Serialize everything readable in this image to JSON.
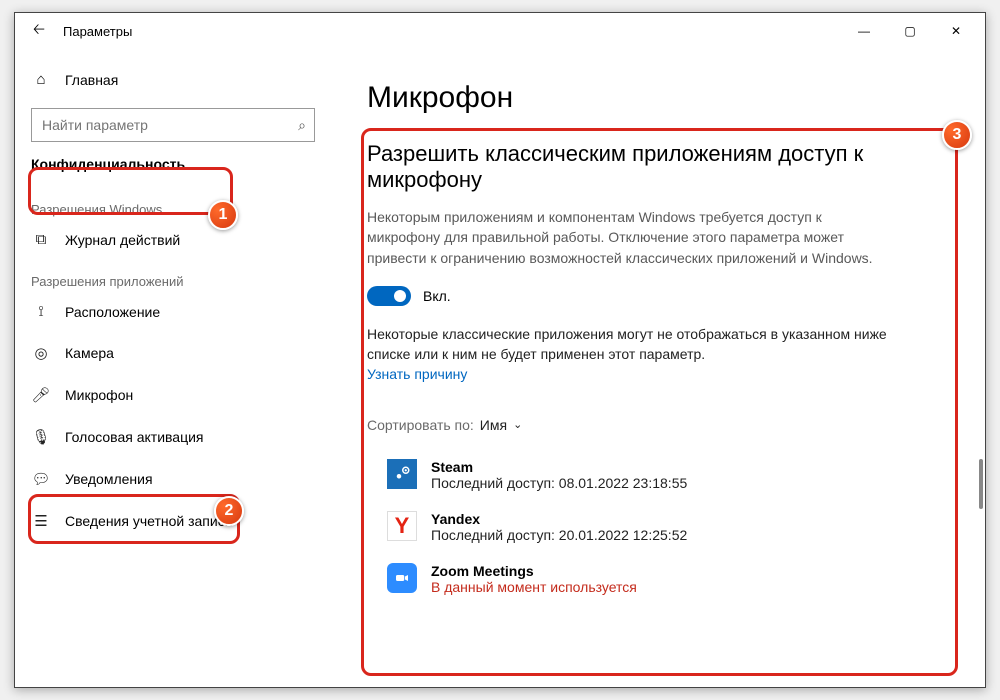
{
  "window": {
    "title": "Параметры"
  },
  "sidebar": {
    "home": "Главная",
    "search_placeholder": "Найти параметр",
    "section_privacy": "Конфиденциальность",
    "group_windows": "Разрешения Windows",
    "item_activity": "Журнал действий",
    "group_apps": "Разрешения приложений",
    "item_location": "Расположение",
    "item_camera": "Камера",
    "item_microphone": "Микрофон",
    "item_voice": "Голосовая активация",
    "item_notifications": "Уведомления",
    "item_account": "Сведения учетной записи"
  },
  "page": {
    "title": "Микрофон",
    "section_heading": "Разрешить классическим приложениям доступ к микрофону",
    "section_para": "Некоторым приложениям и компонентам Windows требуется доступ к микрофону для правильной работы. Отключение этого параметра может привести к ограничению возможностей классических приложений и Windows.",
    "toggle_label": "Вкл.",
    "list_note": "Некоторые классические приложения могут не отображаться в указанном ниже списке или к ним не будет применен этот параметр.",
    "learn_link": "Узнать причину",
    "sort_label": "Сортировать по:",
    "sort_value": "Имя",
    "apps": [
      {
        "name": "Steam",
        "sub": "Последний доступ: 08.01.2022 23:18:55",
        "inuse": false,
        "icon": "steam"
      },
      {
        "name": "Yandex",
        "sub": "Последний доступ: 20.01.2022 12:25:52",
        "inuse": false,
        "icon": "yandex"
      },
      {
        "name": "Zoom Meetings",
        "sub": "В данный момент используется",
        "inuse": true,
        "icon": "zoom"
      }
    ]
  },
  "badges": {
    "b1": "1",
    "b2": "2",
    "b3": "3"
  }
}
